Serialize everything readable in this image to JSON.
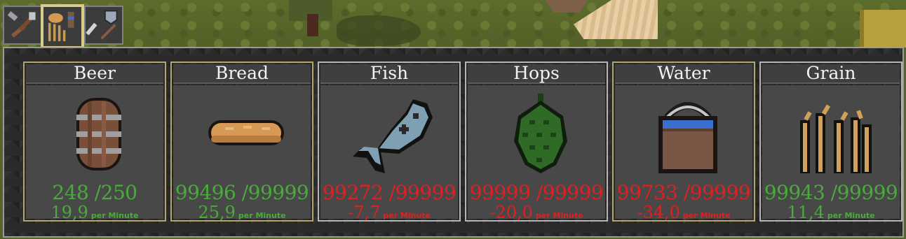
{
  "tabs": [
    {
      "icon": "tools-icon",
      "active": false
    },
    {
      "icon": "food-icon",
      "active": true
    },
    {
      "icon": "weapons-icon",
      "active": false
    }
  ],
  "resources": [
    {
      "name": "Beer",
      "icon": "barrel-icon",
      "amount": "248 /250",
      "rate": "19,9",
      "unit": "per Minute",
      "status": "ok",
      "highlight": true
    },
    {
      "name": "Bread",
      "icon": "bread-icon",
      "amount": "99496 /99999",
      "rate": "25,9",
      "unit": "per Minute",
      "status": "ok",
      "highlight": true
    },
    {
      "name": "Fish",
      "icon": "fish-icon",
      "amount": "99272 /99999",
      "rate": "-7,7",
      "unit": "per Minute",
      "status": "bad",
      "highlight": false
    },
    {
      "name": "Hops",
      "icon": "hops-icon",
      "amount": "99999 /99999",
      "rate": "-20,0",
      "unit": "per Minute",
      "status": "bad",
      "highlight": false
    },
    {
      "name": "Water",
      "icon": "water-bucket-icon",
      "amount": "99733 /99999",
      "rate": "-34,0",
      "unit": "per Minute",
      "status": "bad",
      "highlight": true
    },
    {
      "name": "Grain",
      "icon": "grain-icon",
      "amount": "99943 /99999",
      "rate": "11,4",
      "unit": "per Minute",
      "status": "ok",
      "highlight": false
    }
  ],
  "colors": {
    "ok": "#4aab3c",
    "bad": "#e02020",
    "highlight_border": "#b2a66a"
  }
}
